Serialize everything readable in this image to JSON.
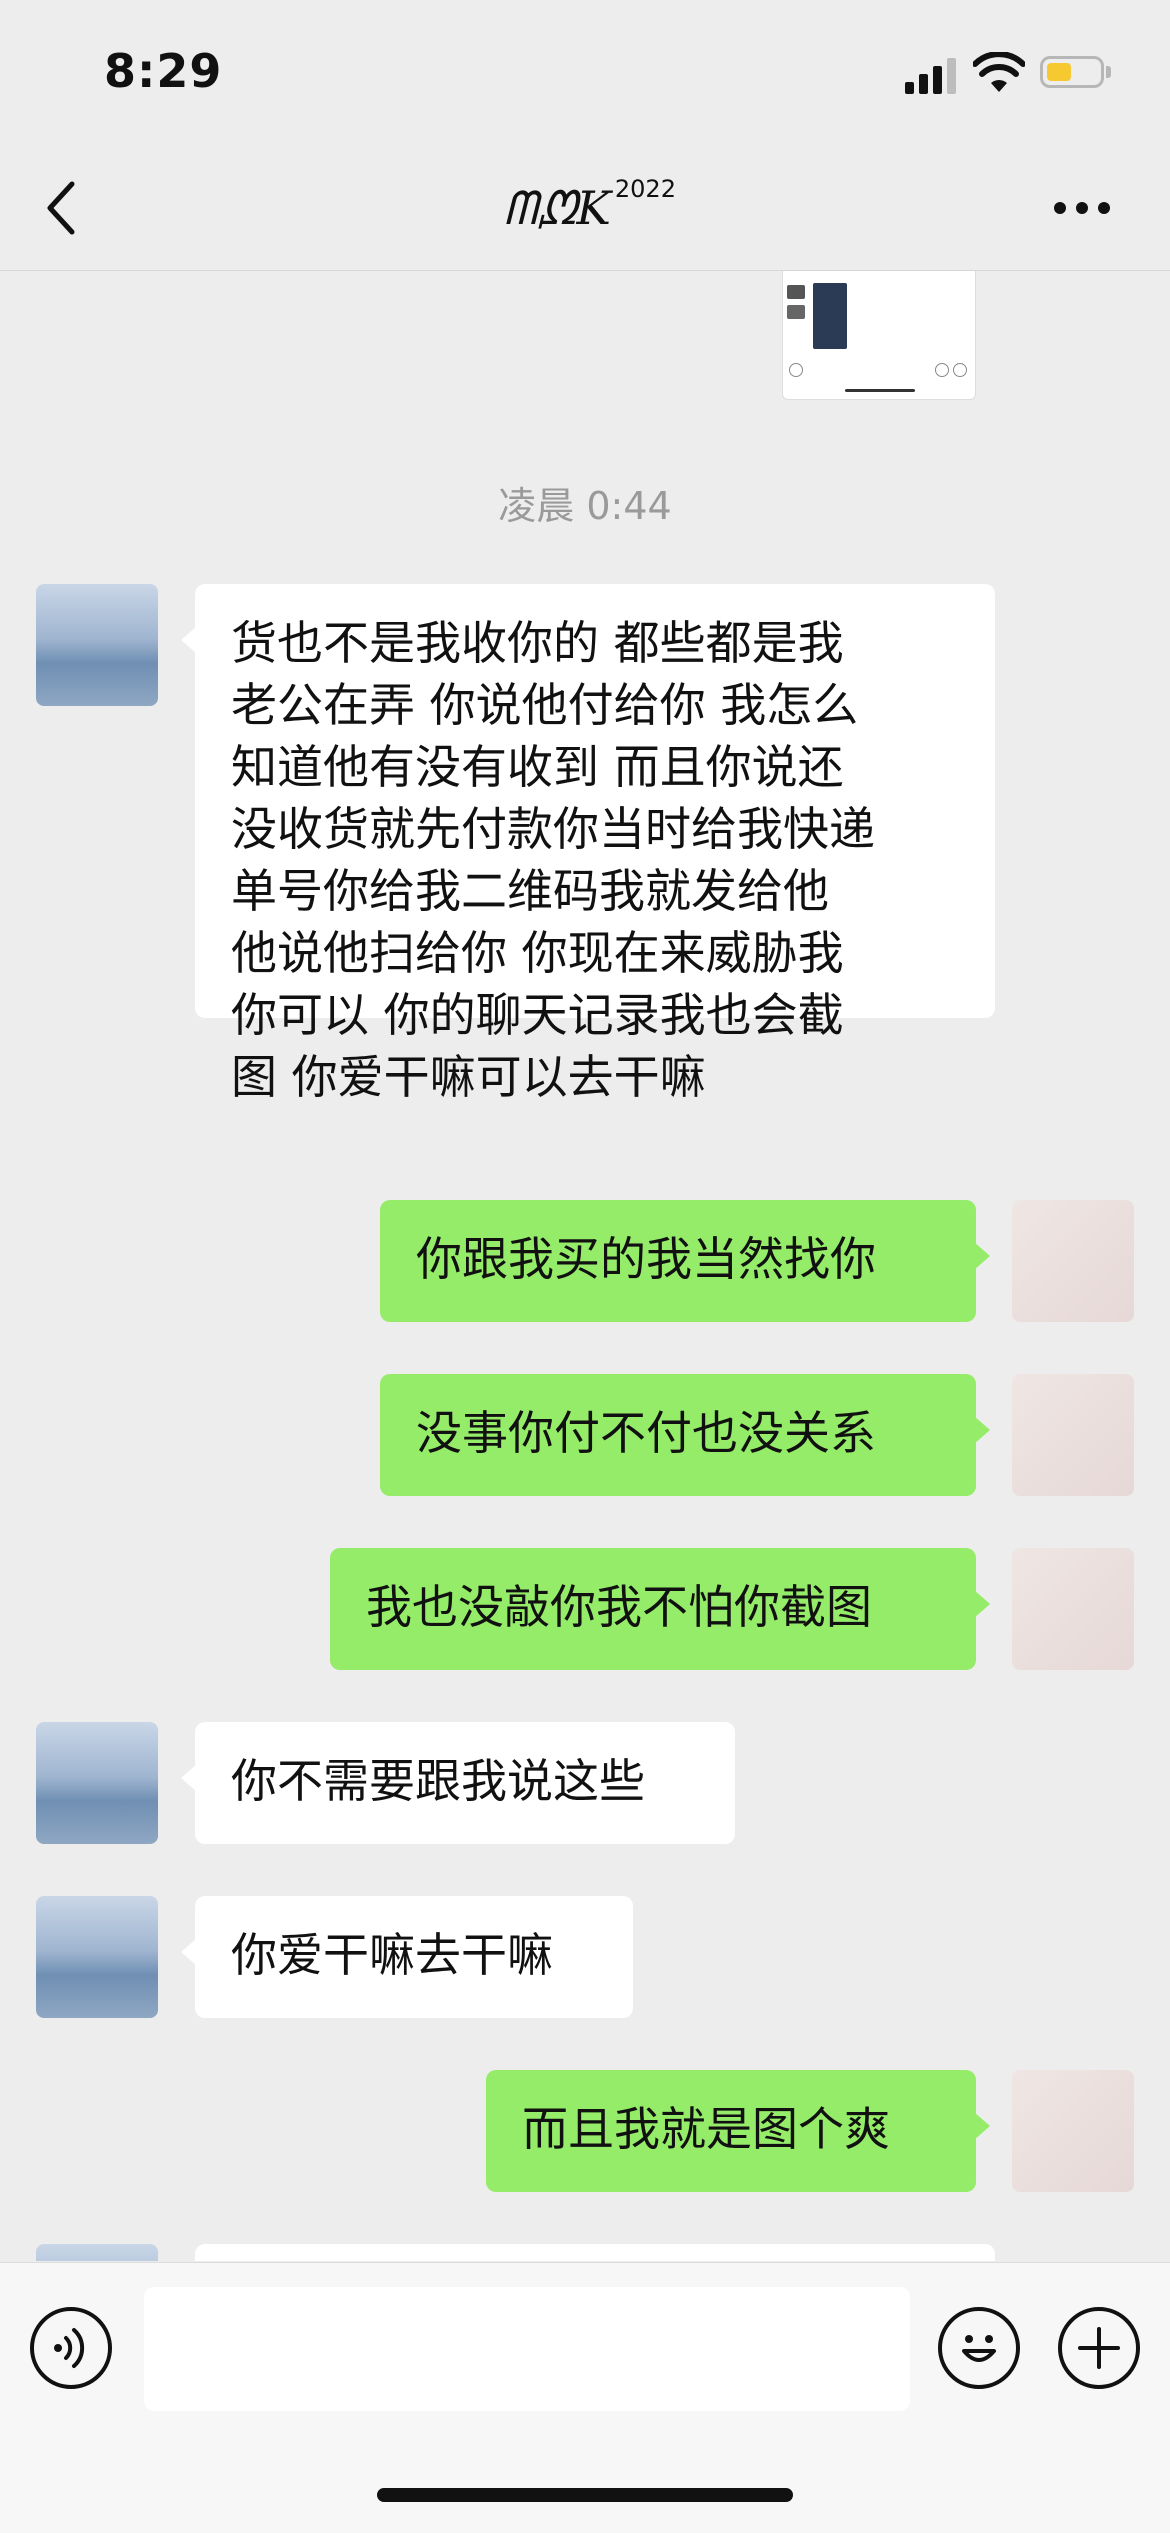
{
  "status_bar": {
    "time": "8:29"
  },
  "nav": {
    "title": "ᗰᘻK",
    "title_sup": "2022"
  },
  "chat": {
    "timestamp": "凌晨 0:44",
    "messages": [
      {
        "side": "left",
        "lines": [
          "货也不是我收你的   都些都是我",
          "老公在弄  你说他付给你  我怎么",
          "知道他有没有收到  而且你说还",
          "没收货就先付款你当时给我快递",
          "单号你给我二维码我就发给他",
          "他说他扫给你   你现在来威胁我",
          "你可以  你的聊天记录我也会截",
          "图  你爱干嘛可以去干嘛"
        ]
      },
      {
        "side": "right",
        "text": "你跟我买的我当然找你"
      },
      {
        "side": "right",
        "text": "没事你付不付也没关系"
      },
      {
        "side": "right",
        "text": "我也没敲你我不怕你截图"
      },
      {
        "side": "left",
        "text": "你不需要跟我说这些"
      },
      {
        "side": "left",
        "text": "你爱干嘛去干嘛"
      },
      {
        "side": "right",
        "text": "而且我就是图个爽"
      }
    ]
  },
  "icons": {
    "back": "chevron-left-icon",
    "more": "more-icon",
    "voice": "voice-icon",
    "emoji": "emoji-icon",
    "plus": "plus-icon"
  },
  "colors": {
    "background": "#ededed",
    "bubble_self": "#95ec69",
    "bubble_other": "#ffffff",
    "battery": "#f7c931"
  }
}
